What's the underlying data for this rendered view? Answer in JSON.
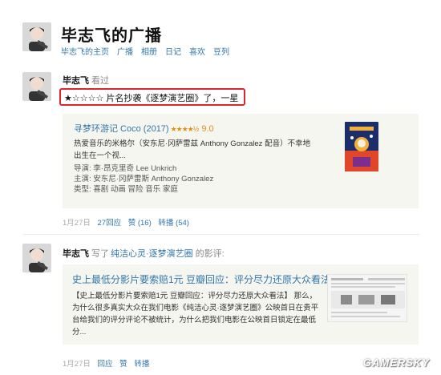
{
  "header": {
    "title": "毕志飞的广播",
    "nav": [
      "毕志飞的主页",
      "广播",
      "相册",
      "日记",
      "喜欢",
      "豆列"
    ]
  },
  "item1": {
    "username": "毕志飞",
    "action": "看过",
    "rating_text": "★☆☆☆☆ 片名抄袭《逐梦演艺圈》了，一星",
    "card": {
      "movie_title": "寻梦环游记 Coco (2017)",
      "stars": "★★★★½",
      "score": "9.0",
      "description": "热爱音乐的米格尔（安东尼·冈萨雷兹 Anthony Gonzalez 配音）不幸地出生在一个视...",
      "director": "导演: 李·昂克里奇 Lee Unkrich",
      "cast": "主演: 安东尼·冈萨雷斯 Anthony Gonzalez",
      "genre": "类型: 喜剧 动画 冒险 音乐 家庭",
      "poster_colors": [
        "#1b2d6b",
        "#e0462a",
        "#f3b13b"
      ]
    },
    "footer": {
      "date": "1月27日",
      "replies": "27回应",
      "likes": "赞 (16)",
      "reshare": "转播 (54)"
    }
  },
  "item2": {
    "username": "毕志飞",
    "action": "写了",
    "ref": "纯洁心灵·逐梦演艺圈",
    "ref_suffix": "的影评:",
    "card": {
      "article_title": "史上最低分影片要索赔1元 豆瓣回应：评分尽力还原大众看法",
      "body": "【史上最低分影片要索赔1元 豆瓣回应：评分尽力还原大众看法】 那么，为什么很多真实大众在我们电影《纯洁心灵·逐梦演艺圈》公映首日在贵平台给我们的评分评论不被统计，为什么把我们电影在公映首日锁定在最低分..."
    },
    "footer": {
      "date": "1月27日",
      "reply": "回应",
      "like": "赞",
      "reshare": "转播"
    }
  },
  "watermark": "GAMERSKY"
}
